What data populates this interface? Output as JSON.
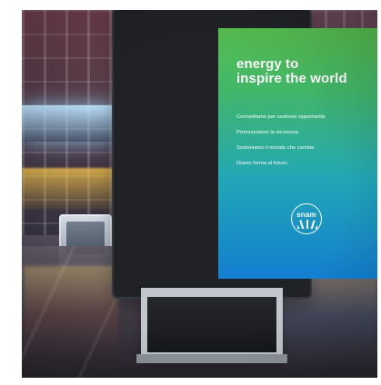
{
  "poster": {
    "headline_lines": [
      "energy to",
      "inspire the world"
    ],
    "messages": [
      "Connettiamo per costruire opportunità",
      "Promuoviamo la sicurezza",
      "Sosteniamo il mondo che cambia",
      "Diamo forma al futuro"
    ],
    "logo_text": "snam"
  },
  "colors": {
    "screen_top": "#57bf4f",
    "screen_bottom": "#137ed0",
    "text": "#ffffff",
    "kiosk_frame": "#202226"
  }
}
